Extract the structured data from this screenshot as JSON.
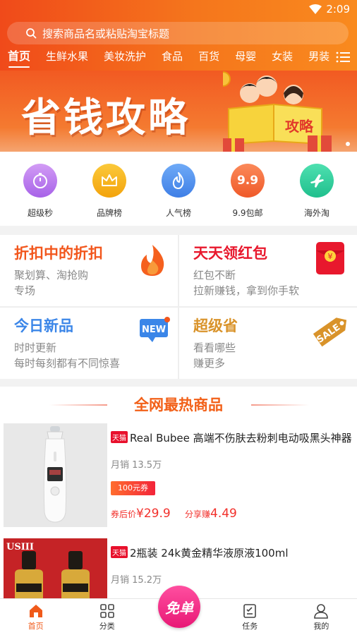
{
  "status_bar": {
    "time": "2:09"
  },
  "search": {
    "placeholder": "搜索商品名或粘贴淘宝标题"
  },
  "tabs": [
    {
      "label": "首页",
      "active": true
    },
    {
      "label": "生鲜水果"
    },
    {
      "label": "美妆洗护"
    },
    {
      "label": "食品"
    },
    {
      "label": "百货"
    },
    {
      "label": "母婴"
    },
    {
      "label": "女装"
    },
    {
      "label": "男装"
    }
  ],
  "banner": {
    "title": "省钱攻略",
    "badge_text": "攻略"
  },
  "quick_links": [
    {
      "label": "超级秒",
      "icon": "stopwatch-icon",
      "color": "#b777ec"
    },
    {
      "label": "品牌榜",
      "icon": "crown-icon",
      "color": "#f7b112"
    },
    {
      "label": "人气榜",
      "icon": "flame-icon",
      "color": "#4a8ff0"
    },
    {
      "label": "9.9包邮",
      "icon": "9.9",
      "color": "#f46a3a"
    },
    {
      "label": "海外淘",
      "icon": "airplane-icon",
      "color": "#2ec99b"
    }
  ],
  "promos": [
    {
      "title": "折扣中的折扣",
      "lines": [
        "聚划算、淘抢购",
        "专场"
      ],
      "color": "#f2561c",
      "icon": "fire-icon"
    },
    {
      "title": "天天领红包",
      "lines": [
        "红包不断",
        "拉新赚钱，拿到你手软"
      ],
      "color": "#e8182d",
      "icon": "red-envelope-icon"
    },
    {
      "title": "今日新品",
      "lines": [
        "时时更新",
        "每时每刻都有不同惊喜"
      ],
      "color": "#3b86e8",
      "icon": "new-tag-icon",
      "badge": "NEW"
    },
    {
      "title": "超级省",
      "lines": [
        "看看哪些",
        "赚更多"
      ],
      "color": "#d9932a",
      "icon": "sale-tag-icon",
      "badge": "SALE"
    }
  ],
  "hot": {
    "title": "全网最热商品",
    "products": [
      {
        "shop_tag": "天猫",
        "title": "Real Bubee  高端不伤肤去粉刺电动吸黑头神器",
        "sales": "月销  13.5万",
        "coupon": "100元券",
        "price_label": "券后价",
        "price": "¥29.9",
        "share_label": "分享赚",
        "share": "4.49"
      },
      {
        "shop_tag": "天猫",
        "title": "2瓶装 24k黄金精华液原液100ml",
        "sales": "月销  15.2万",
        "image_text": "USIII"
      }
    ]
  },
  "bottom_nav": [
    {
      "label": "首页",
      "icon": "home-icon",
      "active": true
    },
    {
      "label": "分类",
      "icon": "grid-icon"
    },
    {
      "label": "任务",
      "icon": "task-icon"
    },
    {
      "label": "我的",
      "icon": "user-icon"
    }
  ],
  "free_button": "免单"
}
